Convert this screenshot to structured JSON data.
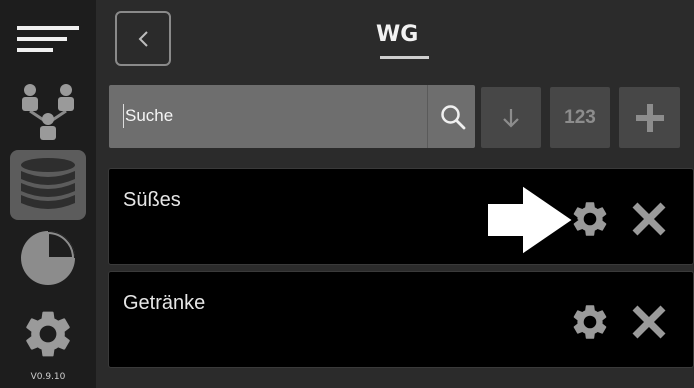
{
  "header": {
    "title": "WG"
  },
  "search": {
    "value": "Suche"
  },
  "toolbar": {
    "sort_numeric_label": "123"
  },
  "sidebar": {
    "items": [
      {
        "name": "menu",
        "icon": "menu-icon",
        "active": false
      },
      {
        "name": "users",
        "icon": "users-icon",
        "active": false
      },
      {
        "name": "database",
        "icon": "database-icon",
        "active": true
      },
      {
        "name": "statistics",
        "icon": "pie-chart-icon",
        "active": false
      },
      {
        "name": "settings",
        "icon": "gear-icon",
        "active": false
      }
    ],
    "version": "V0.9.10"
  },
  "list": {
    "items": [
      {
        "label": "Süßes",
        "highlighted": true
      },
      {
        "label": "Getränke",
        "highlighted": false
      }
    ]
  },
  "colors": {
    "sidebar_bg": "#1d1d1d",
    "main_bg": "#2b2b2b",
    "search_bg": "#6e6e6e",
    "tool_bg": "#474747",
    "row_bg": "#000000",
    "icon_gray": "#9a9a9a"
  }
}
